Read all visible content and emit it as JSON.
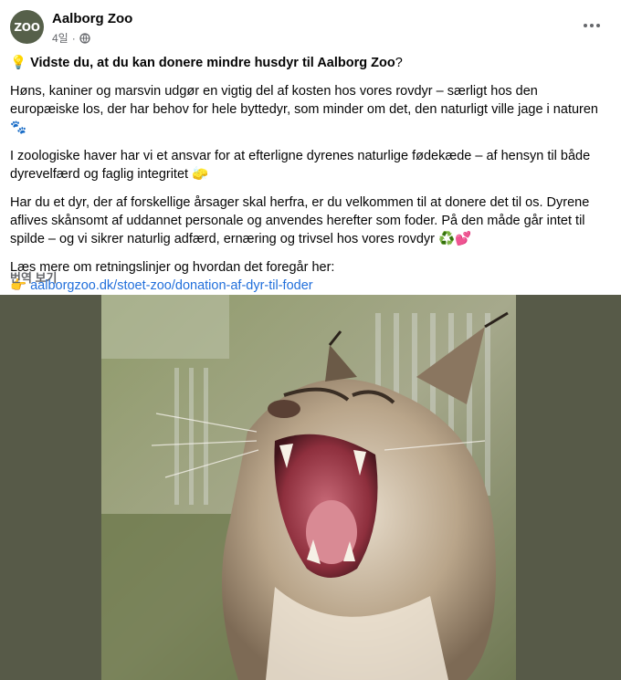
{
  "page": {
    "name": "Aalborg Zoo",
    "avatar_text": "ZOO",
    "time_ago": "4일",
    "separator": "·"
  },
  "post": {
    "title_emoji": "💡",
    "title": "Vidste du, at du kan donere mindre husdyr til Aalborg Zoo",
    "title_suffix": "?",
    "paragraph1": "Høns, kaniner og marsvin udgør en vigtig del af kosten hos vores rovdyr – særligt hos den europæiske los, der har behov for hele byttedyr, som minder om det, den naturligt ville jage i naturen",
    "paragraph1_emoji": "🐾",
    "paragraph2": "I zoologiske haver har vi et ansvar for at efterligne dyrenes naturlige fødekæde – af hensyn til både dyrevelfærd og faglig integritet",
    "paragraph2_emoji": "🧽",
    "paragraph3": "Har du et dyr, der af forskellige årsager skal herfra, er du velkommen til at donere det til os. Dyrene aflives skånsomt af uddannet personale og anvendes herefter som foder. På den måde går intet til spilde – og vi sikrer naturlig adfærd, ernæring og trivsel hos vores rovdyr",
    "paragraph3_emoji": "♻️💕",
    "paragraph4": "Læs mere om retningslinjer og hvordan det foregår her:",
    "link_emoji": "👉",
    "link_text": "aalborgzoo.dk/stoet-zoo/donation-af-dyr-til-foder",
    "translate_label": "번역 보기"
  },
  "icons": {
    "globe": "globe-icon",
    "more": "more-icon"
  },
  "colors": {
    "link": "#216fdb",
    "meta": "#65676b",
    "media_background": "#575a48",
    "avatar": "#56604a"
  }
}
